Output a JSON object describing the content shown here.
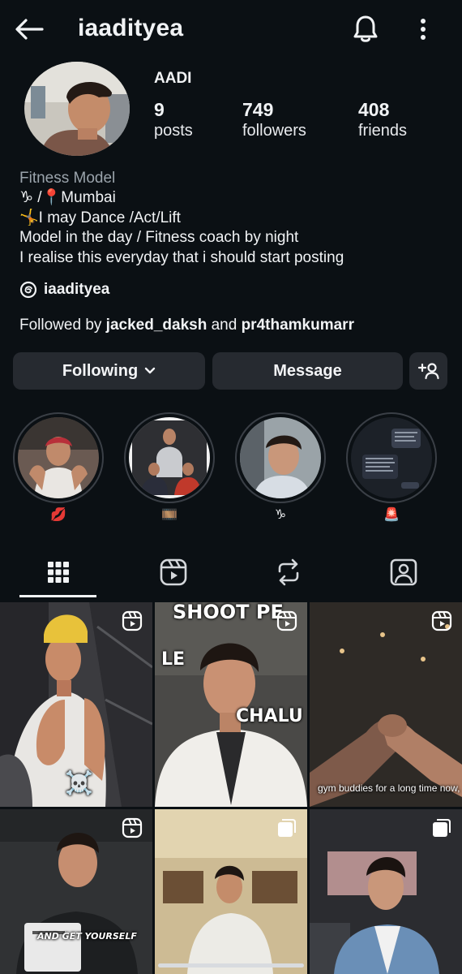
{
  "header": {
    "username": "iaadityea"
  },
  "profile": {
    "display_name": "AADI",
    "stats": [
      {
        "value": "9",
        "label": "posts"
      },
      {
        "value": "749",
        "label": "followers"
      },
      {
        "value": "408",
        "label": "friends"
      }
    ],
    "category": "Fitness Model",
    "bio_lines": [
      "♑ /📍Mumbai",
      "🤸I may Dance /Act/Lift",
      "Model in the day / Fitness coach by night",
      "I realise this everyday that i should start posting"
    ],
    "threads_handle": "iaadityea",
    "followed_by": {
      "prefix": "Followed by",
      "user1": "jacked_daksh",
      "joiner": "and",
      "user2": "pr4thamkumarr"
    }
  },
  "actions": {
    "following_label": "Following",
    "message_label": "Message"
  },
  "highlights": [
    {
      "label": "💋"
    },
    {
      "label": "🎞️"
    },
    {
      "label": "♑"
    },
    {
      "label": "🚨"
    }
  ],
  "tabs": [
    "grid",
    "reels",
    "reposts",
    "tagged"
  ],
  "posts": [
    {
      "type": "reel",
      "overlay": "☠️"
    },
    {
      "type": "reel",
      "overlay_top": "SHOOT PE",
      "overlay_left": "LE",
      "overlay_right": "CHALU"
    },
    {
      "type": "reel",
      "caption": "gym buddies for a long time now,"
    },
    {
      "type": "reel",
      "caption": "AND GET YOURSELF"
    },
    {
      "type": "carousel"
    },
    {
      "type": "carousel"
    }
  ],
  "colors": {
    "background": "#0b1014",
    "button": "#262a30",
    "text": "#f1f3f5",
    "muted": "#9aa3ab"
  }
}
